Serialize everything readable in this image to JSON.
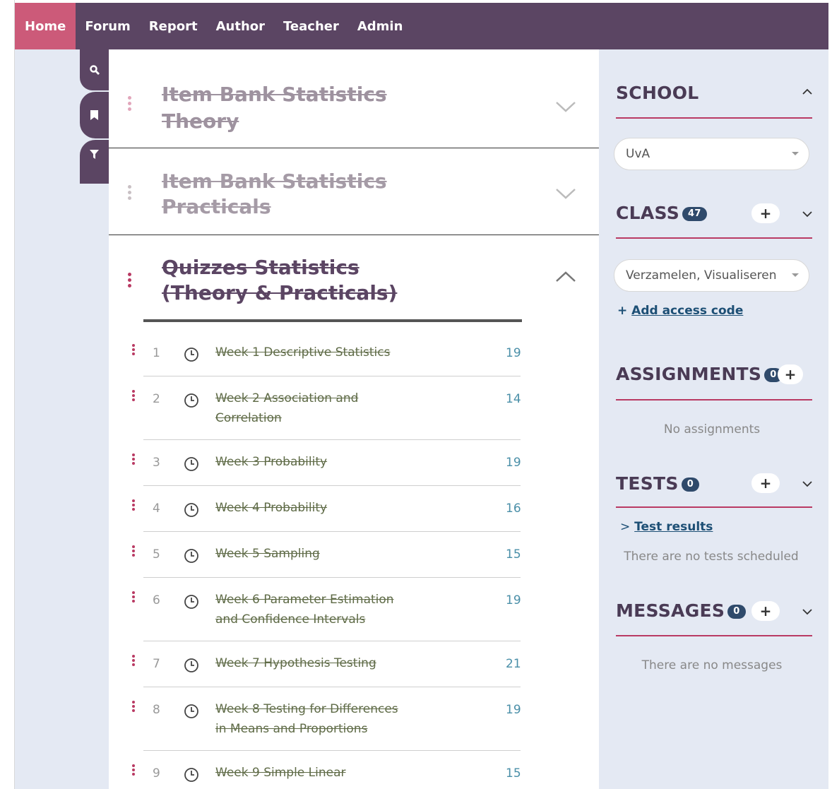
{
  "nav": {
    "items": [
      {
        "label": "Home",
        "active": true
      },
      {
        "label": "Forum"
      },
      {
        "label": "Report"
      },
      {
        "label": "Author"
      },
      {
        "label": "Teacher"
      },
      {
        "label": "Admin"
      }
    ]
  },
  "tools": [
    "search-icon",
    "bookmark-icon",
    "filter-icon"
  ],
  "sections": [
    {
      "title_line1": "Item Bank Statistics",
      "title_line2": "Theory",
      "expanded": false
    },
    {
      "title_line1": "Item Bank Statistics",
      "title_line2": "Practicals",
      "expanded": false
    },
    {
      "title_line1": "Quizzes Statistics",
      "title_line2": "(Theory & Practicals)",
      "expanded": true
    }
  ],
  "quizzes": [
    {
      "num": "1",
      "line1": "Week 1 Descriptive Statistics",
      "line2": "",
      "count": "19"
    },
    {
      "num": "2",
      "line1": "Week 2 Association and",
      "line2": "Correlation",
      "count": "14"
    },
    {
      "num": "3",
      "line1": "Week 3 Probability",
      "line2": "",
      "count": "19"
    },
    {
      "num": "4",
      "line1": "Week 4 Probability",
      "line2": "",
      "count": "16"
    },
    {
      "num": "5",
      "line1": "Week 5 Sampling",
      "line2": "",
      "count": "15"
    },
    {
      "num": "6",
      "line1": "Week 6 Parameter Estimation",
      "line2": "and Confidence Intervals",
      "count": "19"
    },
    {
      "num": "7",
      "line1": "Week 7 Hypothesis Testing",
      "line2": "",
      "count": "21"
    },
    {
      "num": "8",
      "line1": "Week 8 Testing for Differences",
      "line2": "in Means and Proportions",
      "count": "19"
    },
    {
      "num": "9",
      "line1": "Week 9 Simple Linear",
      "line2": "",
      "count": "15"
    }
  ],
  "sidebar": {
    "school": {
      "title": "SCHOOL",
      "selected": "UvA"
    },
    "class": {
      "title": "CLASS",
      "badge": "47",
      "selected": "Verzamelen, Visualiseren",
      "add_access_code": "Add access code",
      "add_access_code_prefix": "+"
    },
    "assignments": {
      "title": "ASSIGNMENTS",
      "badge": "0",
      "empty": "No assignments"
    },
    "tests": {
      "title": "TESTS",
      "badge": "0",
      "results_prefix": ">",
      "results_link": "Test results",
      "empty": "There are no tests scheduled"
    },
    "messages": {
      "title": "MESSAGES",
      "badge": "0",
      "empty": "There are no messages"
    },
    "plus_label": "+",
    "caret_down": "⌄",
    "caret_up": "^"
  },
  "colors": {
    "nav_bg": "#5b4563",
    "nav_active": "#cc5a79",
    "accent": "#b93a63",
    "side_bg": "#e4e9f3",
    "badge": "#2f4a6b"
  }
}
